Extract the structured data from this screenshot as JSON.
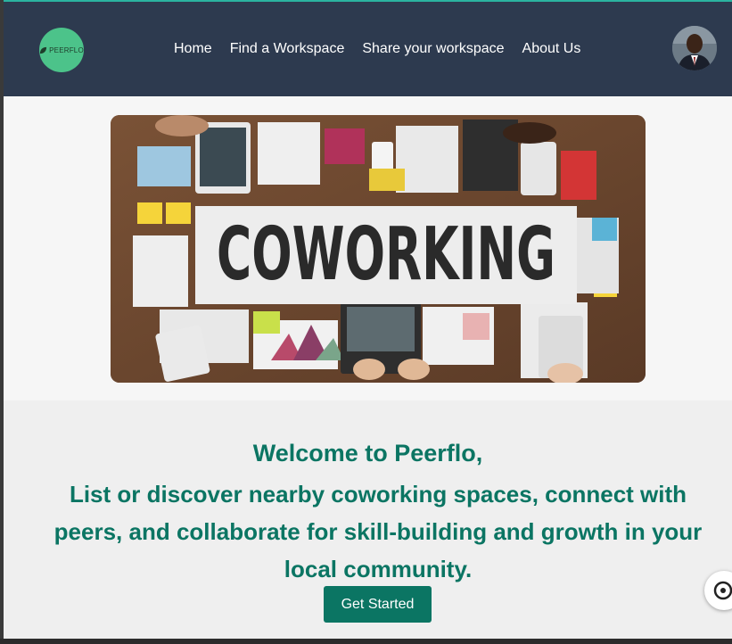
{
  "brand": {
    "logo_text": "PEERFLO",
    "accent": "#0b7563",
    "nav_bg": "#2d3a4f",
    "logo_bg": "#4cc38a"
  },
  "nav": {
    "links": [
      "Home",
      "Find a Workspace",
      "Share your workspace",
      "About Us"
    ]
  },
  "hero": {
    "banner_text": "COWORKING"
  },
  "welcome": {
    "title": "Welcome to Peerflo,",
    "body": "List or discover nearby coworking spaces, connect with peers, and collaborate for skill-building and growth in your local community.",
    "cta_label": "Get Started"
  },
  "icons": {
    "avatar": "user-avatar",
    "float": "accessibility-icon"
  }
}
